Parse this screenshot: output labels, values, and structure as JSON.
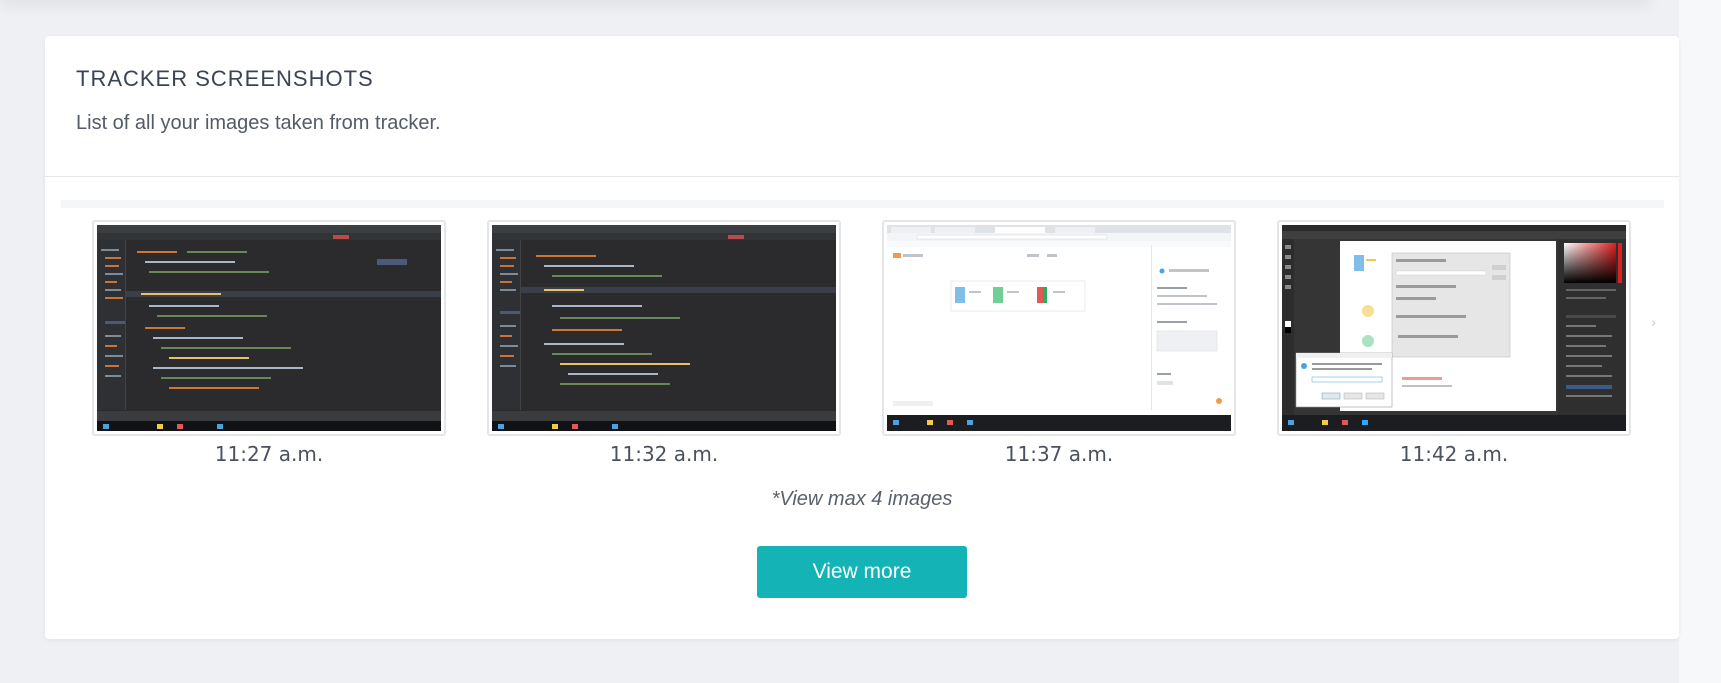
{
  "section": {
    "title": "TRACKER SCREENSHOTS",
    "subtitle": "List of all your images taken from tracker."
  },
  "screenshots": [
    {
      "time": "11:27 a.m.",
      "thumbnail": "ide-dark-screenshot"
    },
    {
      "time": "11:32 a.m.",
      "thumbnail": "ide-dark-screenshot"
    },
    {
      "time": "11:37 a.m.",
      "thumbnail": "browser-light-screenshot"
    },
    {
      "time": "11:42 a.m.",
      "thumbnail": "photoshop-dialog-screenshot"
    }
  ],
  "note": "*View max 4 images",
  "buttons": {
    "view_more": "View more"
  },
  "icons": {
    "next": "chevron-right-icon"
  },
  "colors": {
    "accent": "#14b4b6",
    "background": "#eef0f4"
  }
}
